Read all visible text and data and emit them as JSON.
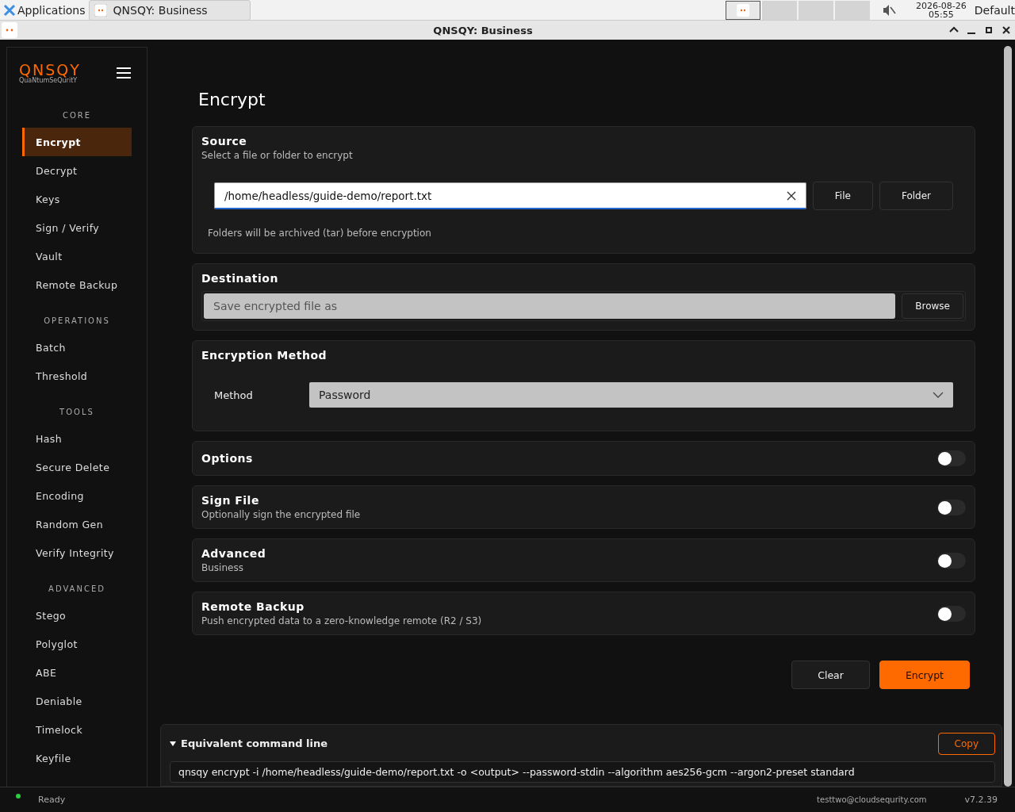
{
  "taskbar": {
    "menu": "Applications",
    "task": "QNSQY: Business",
    "date": "2026-08-26",
    "time": "05:55",
    "layout": "Default"
  },
  "window": {
    "title": "QNSQY: Business"
  },
  "sidebar": {
    "logo": "QNSQY",
    "tagline": "QuaNtumSeQuritY",
    "sections": [
      {
        "heading": "CORE",
        "items": [
          {
            "label": "Encrypt",
            "selected": true
          },
          {
            "label": "Decrypt",
            "selected": false
          },
          {
            "label": "Keys",
            "selected": false
          },
          {
            "label": "Sign / Verify",
            "selected": false
          },
          {
            "label": "Vault",
            "selected": false
          },
          {
            "label": "Remote Backup",
            "selected": false
          }
        ]
      },
      {
        "heading": "OPERATIONS",
        "items": [
          {
            "label": "Batch",
            "selected": false
          },
          {
            "label": "Threshold",
            "selected": false
          }
        ]
      },
      {
        "heading": "TOOLS",
        "items": [
          {
            "label": "Hash",
            "selected": false
          },
          {
            "label": "Secure Delete",
            "selected": false
          },
          {
            "label": "Encoding",
            "selected": false
          },
          {
            "label": "Random Gen",
            "selected": false
          },
          {
            "label": "Verify Integrity",
            "selected": false
          }
        ]
      },
      {
        "heading": "ADVANCED",
        "items": [
          {
            "label": "Stego",
            "selected": false
          },
          {
            "label": "Polyglot",
            "selected": false
          },
          {
            "label": "ABE",
            "selected": false
          },
          {
            "label": "Deniable",
            "selected": false
          },
          {
            "label": "Timelock",
            "selected": false
          },
          {
            "label": "Keyfile",
            "selected": false
          }
        ]
      }
    ]
  },
  "page": {
    "title": "Encrypt"
  },
  "source": {
    "title": "Source",
    "subtitle": "Select a file or folder to encrypt",
    "value": "/home/headless/guide-demo/report.txt",
    "buttons": [
      "File",
      "Folder"
    ],
    "note": "Folders will be archived (tar) before encryption"
  },
  "destination": {
    "title": "Destination",
    "placeholder": "Save encrypted file as",
    "button": "Browse"
  },
  "method": {
    "title": "Encryption Method",
    "label": "Method",
    "value": "Password"
  },
  "toggles": [
    {
      "title": "Options",
      "on": false
    },
    {
      "title": "Sign File",
      "subtitle": "Optionally sign the encrypted file",
      "on": false
    },
    {
      "title": "Advanced",
      "subtitle": "Business",
      "on": false
    },
    {
      "title": "Remote Backup",
      "subtitle": "Push encrypted data to a zero-knowledge remote (R2 / S3)",
      "on": false
    }
  ],
  "actions": [
    {
      "label": "Clear",
      "kind": "secondary"
    },
    {
      "label": "Encrypt",
      "kind": "primary"
    }
  ],
  "command": {
    "title": "Equivalent command line",
    "expanded": true,
    "copy": "Copy",
    "text": "qnsqy encrypt -i /home/headless/guide-demo/report.txt -o <output> --password-stdin --algorithm aes256-gcm --argon2-preset standard"
  },
  "status": {
    "text": "Ready",
    "user": "testtwo@cloudsequrity.com",
    "version": "v7.2.39"
  }
}
